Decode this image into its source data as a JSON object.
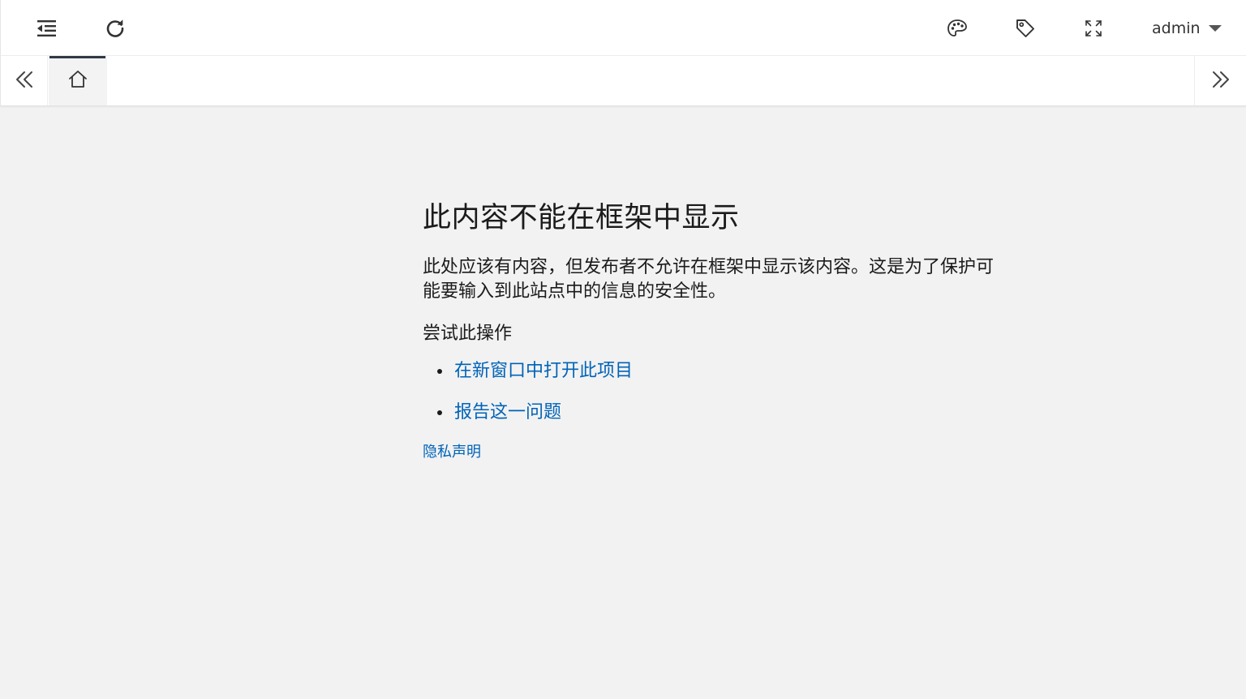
{
  "topbar": {
    "menu_icon": "menu-collapse-icon",
    "refresh_icon": "refresh-icon",
    "theme_icon": "palette-icon",
    "tag_icon": "tag-icon",
    "fullscreen_icon": "fullscreen-icon",
    "user_name": "admin",
    "user_caret_icon": "caret-down-icon"
  },
  "tabs": {
    "prev_icon": "double-chevron-left-icon",
    "next_icon": "double-chevron-right-icon",
    "home_icon": "home-icon",
    "active_indicator_color": "#2f3a45"
  },
  "error_page": {
    "title": "此内容不能在框架中显示",
    "description": "此处应该有内容，但发布者不允许在框架中显示该内容。这是为了保护可能要输入到此站点中的信息的安全性。",
    "try_heading": "尝试此操作",
    "actions": [
      {
        "label": "在新窗口中打开此项目"
      },
      {
        "label": "报告这一问题"
      }
    ],
    "privacy_link": "隐私声明",
    "link_color": "#0063b8"
  },
  "colors": {
    "background": "#f2f2f2",
    "header_background": "#ffffff",
    "text": "#1b1b1b"
  }
}
